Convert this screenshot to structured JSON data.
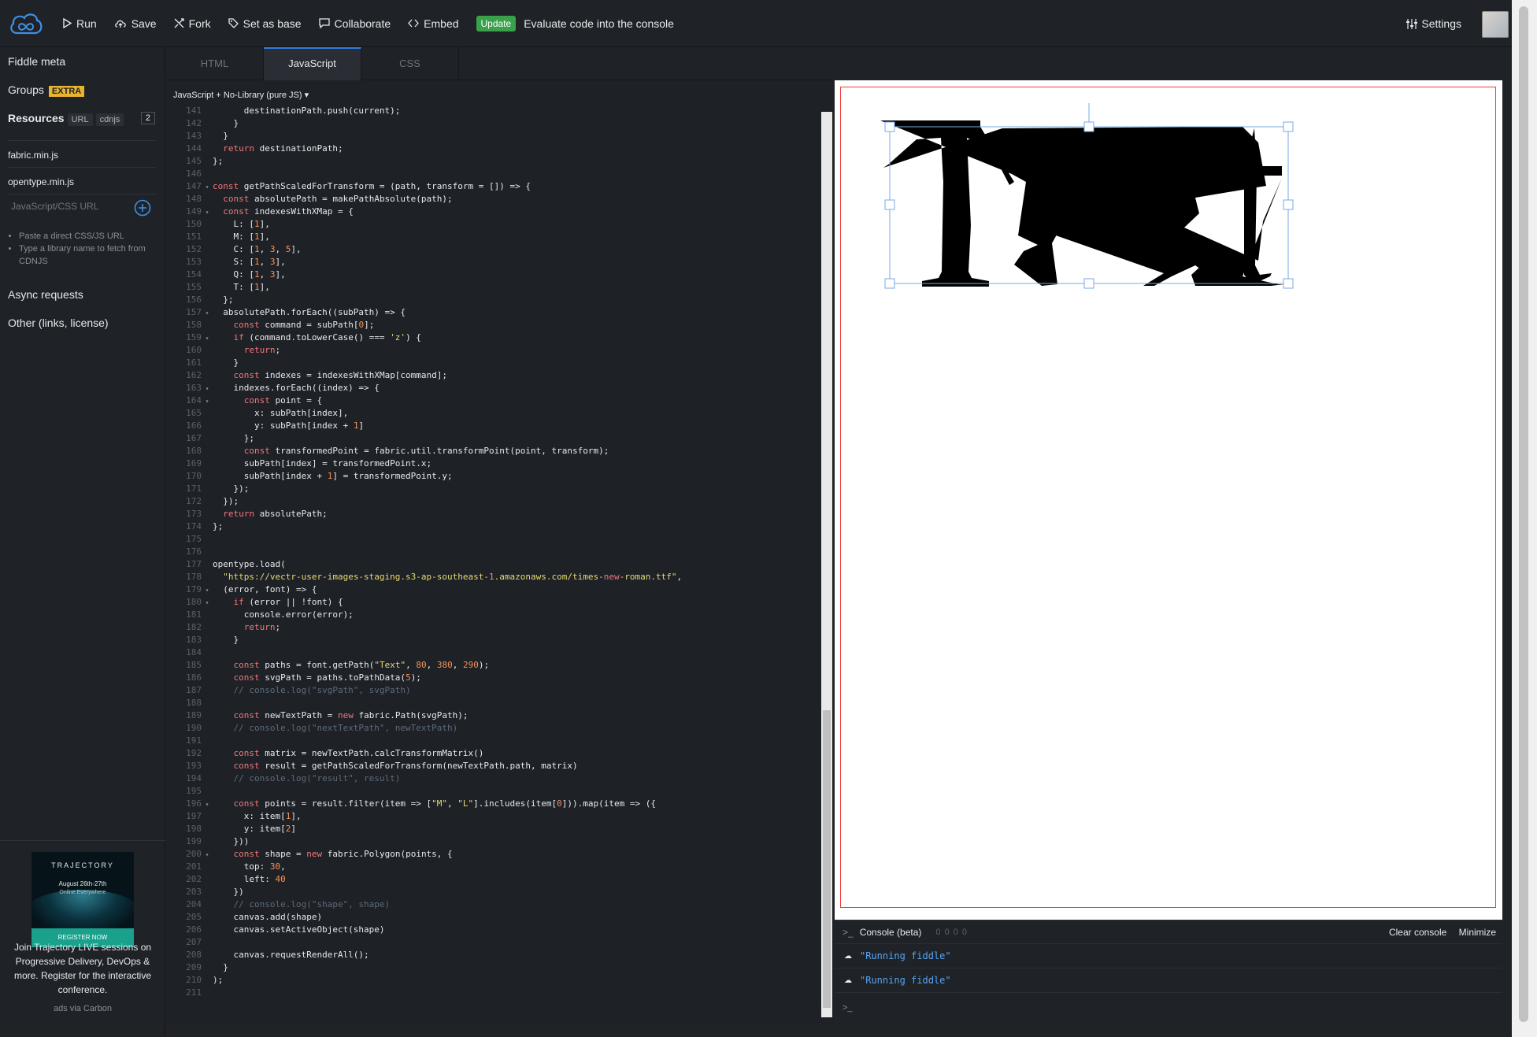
{
  "header": {
    "run_label": "Run",
    "save_label": "Save",
    "fork_label": "Fork",
    "set_as_base_label": "Set as base",
    "collaborate_label": "Collaborate",
    "embed_label": "Embed",
    "update_badge": "Update",
    "evaluate_text": "Evaluate code into the console",
    "settings_label": "Settings"
  },
  "sidebar": {
    "fiddle_meta": "Fiddle meta",
    "groups": "Groups",
    "extra_badge": "EXTRA",
    "resources": "Resources",
    "url_pill": "URL",
    "cdnjs_pill": "cdnjs",
    "resource_count": "2",
    "resource_1": "fabric.min.js",
    "resource_2": "opentype.min.js",
    "url_placeholder": "JavaScript/CSS URL",
    "hint_1": "Paste a direct CSS/JS URL",
    "hint_2": "Type a library name to fetch from CDNJS",
    "async_requests": "Async requests",
    "other": "Other (links, license)"
  },
  "ad": {
    "brand": "TRAJECTORY",
    "date": "August 26th-27th",
    "sub": "Online Everywhere",
    "register": "REGISTER NOW",
    "text": "Join Trajectory LIVE sessions on Progressive Delivery, DevOps & more. Register for the interactive conference.",
    "via": "ads via Carbon"
  },
  "tabs": [
    "HTML",
    "JavaScript",
    "CSS"
  ],
  "editor": {
    "mode": "JavaScript + No-Library (pure JS) ▾",
    "lines": [
      {
        "n": "141",
        "f": "",
        "t": "      destinationPath.push(current);"
      },
      {
        "n": "142",
        "f": "",
        "t": "    }"
      },
      {
        "n": "143",
        "f": "",
        "t": "  }"
      },
      {
        "n": "144",
        "f": "",
        "t": "  return destinationPath;"
      },
      {
        "n": "145",
        "f": "",
        "t": "};"
      },
      {
        "n": "146",
        "f": "",
        "t": ""
      },
      {
        "n": "147",
        "f": "▾",
        "t": "const getPathScaledForTransform = (path, transform = []) => {"
      },
      {
        "n": "148",
        "f": "",
        "t": "  const absolutePath = makePathAbsolute(path);"
      },
      {
        "n": "149",
        "f": "▾",
        "t": "  const indexesWithXMap = {"
      },
      {
        "n": "150",
        "f": "",
        "t": "    L: [1],"
      },
      {
        "n": "151",
        "f": "",
        "t": "    M: [1],"
      },
      {
        "n": "152",
        "f": "",
        "t": "    C: [1, 3, 5],"
      },
      {
        "n": "153",
        "f": "",
        "t": "    S: [1, 3],"
      },
      {
        "n": "154",
        "f": "",
        "t": "    Q: [1, 3],"
      },
      {
        "n": "155",
        "f": "",
        "t": "    T: [1],"
      },
      {
        "n": "156",
        "f": "",
        "t": "  };"
      },
      {
        "n": "157",
        "f": "▾",
        "t": "  absolutePath.forEach((subPath) => {"
      },
      {
        "n": "158",
        "f": "",
        "t": "    const command = subPath[0];"
      },
      {
        "n": "159",
        "f": "▾",
        "t": "    if (command.toLowerCase() === 'z') {"
      },
      {
        "n": "160",
        "f": "",
        "t": "      return;"
      },
      {
        "n": "161",
        "f": "",
        "t": "    }"
      },
      {
        "n": "162",
        "f": "",
        "t": "    const indexes = indexesWithXMap[command];"
      },
      {
        "n": "163",
        "f": "▾",
        "t": "    indexes.forEach((index) => {"
      },
      {
        "n": "164",
        "f": "▾",
        "t": "      const point = {"
      },
      {
        "n": "165",
        "f": "",
        "t": "        x: subPath[index],"
      },
      {
        "n": "166",
        "f": "",
        "t": "        y: subPath[index + 1]"
      },
      {
        "n": "167",
        "f": "",
        "t": "      };"
      },
      {
        "n": "168",
        "f": "",
        "t": "      const transformedPoint = fabric.util.transformPoint(point, transform);"
      },
      {
        "n": "169",
        "f": "",
        "t": "      subPath[index] = transformedPoint.x;"
      },
      {
        "n": "170",
        "f": "",
        "t": "      subPath[index + 1] = transformedPoint.y;"
      },
      {
        "n": "171",
        "f": "",
        "t": "    });"
      },
      {
        "n": "172",
        "f": "",
        "t": "  });"
      },
      {
        "n": "173",
        "f": "",
        "t": "  return absolutePath;"
      },
      {
        "n": "174",
        "f": "",
        "t": "};"
      },
      {
        "n": "175",
        "f": "",
        "t": ""
      },
      {
        "n": "176",
        "f": "",
        "t": ""
      },
      {
        "n": "177",
        "f": "",
        "t": "opentype.load("
      },
      {
        "n": "178",
        "f": "",
        "t": "  \"https://vectr-user-images-staging.s3-ap-southeast-1.amazonaws.com/times-new-roman.ttf\","
      },
      {
        "n": "179",
        "f": "▾",
        "t": "  (error, font) => {"
      },
      {
        "n": "180",
        "f": "▾",
        "t": "    if (error || !font) {"
      },
      {
        "n": "181",
        "f": "",
        "t": "      console.error(error);"
      },
      {
        "n": "182",
        "f": "",
        "t": "      return;"
      },
      {
        "n": "183",
        "f": "",
        "t": "    }"
      },
      {
        "n": "184",
        "f": "",
        "t": ""
      },
      {
        "n": "185",
        "f": "",
        "t": "    const paths = font.getPath(\"Text\", 80, 380, 290);"
      },
      {
        "n": "186",
        "f": "",
        "t": "    const svgPath = paths.toPathData(5);"
      },
      {
        "n": "187",
        "f": "",
        "t": "    // console.log(\"svgPath\", svgPath)"
      },
      {
        "n": "188",
        "f": "",
        "t": ""
      },
      {
        "n": "189",
        "f": "",
        "t": "    const newTextPath = new fabric.Path(svgPath);"
      },
      {
        "n": "190",
        "f": "",
        "t": "    // console.log(\"nextTextPath\", newTextPath)"
      },
      {
        "n": "191",
        "f": "",
        "t": ""
      },
      {
        "n": "192",
        "f": "",
        "t": "    const matrix = newTextPath.calcTransformMatrix()"
      },
      {
        "n": "193",
        "f": "",
        "t": "    const result = getPathScaledForTransform(newTextPath.path, matrix)"
      },
      {
        "n": "194",
        "f": "",
        "t": "    // console.log(\"result\", result)"
      },
      {
        "n": "195",
        "f": "",
        "t": ""
      },
      {
        "n": "196",
        "f": "▾",
        "t": "    const points = result.filter(item => [\"M\", \"L\"].includes(item[0])).map(item => ({"
      },
      {
        "n": "197",
        "f": "",
        "t": "      x: item[1],"
      },
      {
        "n": "198",
        "f": "",
        "t": "      y: item[2]"
      },
      {
        "n": "199",
        "f": "",
        "t": "    }))"
      },
      {
        "n": "200",
        "f": "▾",
        "t": "    const shape = new fabric.Polygon(points, {"
      },
      {
        "n": "201",
        "f": "",
        "t": "      top: 30,"
      },
      {
        "n": "202",
        "f": "",
        "t": "      left: 40"
      },
      {
        "n": "203",
        "f": "",
        "t": "    })"
      },
      {
        "n": "204",
        "f": "",
        "t": "    // console.log(\"shape\", shape)"
      },
      {
        "n": "205",
        "f": "",
        "t": "    canvas.add(shape)"
      },
      {
        "n": "206",
        "f": "",
        "t": "    canvas.setActiveObject(shape)"
      },
      {
        "n": "207",
        "f": "",
        "t": ""
      },
      {
        "n": "208",
        "f": "",
        "t": "    canvas.requestRenderAll();"
      },
      {
        "n": "209",
        "f": "",
        "t": "  }"
      },
      {
        "n": "210",
        "f": "",
        "t": ");"
      },
      {
        "n": "211",
        "f": "",
        "t": ""
      }
    ]
  },
  "console": {
    "title": "Console (beta)",
    "counts": "0  0  0  0",
    "clear": "Clear console",
    "minimize": "Minimize",
    "messages": [
      "\"Running fiddle\"",
      "\"Running fiddle\""
    ],
    "prompt": ">_"
  },
  "colors": {
    "accent_blue": "#2f7ddb",
    "update_green": "#39a14a",
    "extra_yellow": "#e8b32e",
    "canvas_border_red": "#ef3a3a",
    "selection_blue": "#7aa9e6"
  }
}
